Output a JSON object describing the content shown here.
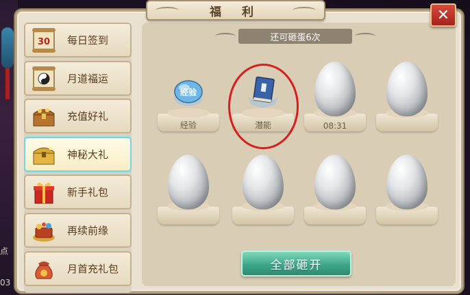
{
  "title": "福 利",
  "close_label": "✕",
  "counter": "还可砸蛋6次",
  "sidebar": {
    "items": [
      {
        "label": "每日签到",
        "icon": "calendar-scroll-icon",
        "active": false
      },
      {
        "label": "月道福运",
        "icon": "yin-yang-scroll-icon",
        "active": false
      },
      {
        "label": "充值好礼",
        "icon": "treasure-chest-icon",
        "active": false
      },
      {
        "label": "神秘大礼",
        "icon": "golden-chest-icon",
        "active": true
      },
      {
        "label": "新手礼包",
        "icon": "gift-box-icon",
        "active": false
      },
      {
        "label": "再续前缘",
        "icon": "treasure-pile-icon",
        "active": false
      },
      {
        "label": "月首充礼包",
        "icon": "money-bag-icon",
        "active": false
      }
    ],
    "calendar_number": "30"
  },
  "slots": [
    {
      "caption": "经验",
      "state": "opened",
      "reward_icon": "exp-orb-icon",
      "badge": "经验"
    },
    {
      "caption": "潜能",
      "state": "opened",
      "reward_icon": "blue-book-icon",
      "badge": ""
    },
    {
      "caption": "08:31",
      "state": "egg",
      "reward_icon": "",
      "badge": ""
    },
    {
      "caption": "",
      "state": "egg",
      "reward_icon": "",
      "badge": ""
    },
    {
      "caption": "",
      "state": "egg",
      "reward_icon": "",
      "badge": ""
    },
    {
      "caption": "",
      "state": "egg",
      "reward_icon": "",
      "badge": ""
    },
    {
      "caption": "",
      "state": "egg",
      "reward_icon": "",
      "badge": ""
    },
    {
      "caption": "",
      "state": "egg",
      "reward_icon": "",
      "badge": ""
    }
  ],
  "smash_all_label": "全部砸开",
  "background_text": [
    "点",
    "03"
  ],
  "colors": {
    "panel": "#e9e0cf",
    "accent_active": "#6fd6e6",
    "close_red": "#c0352a",
    "button_green": "#3ea789",
    "highlight_ring": "#d81d1d"
  }
}
